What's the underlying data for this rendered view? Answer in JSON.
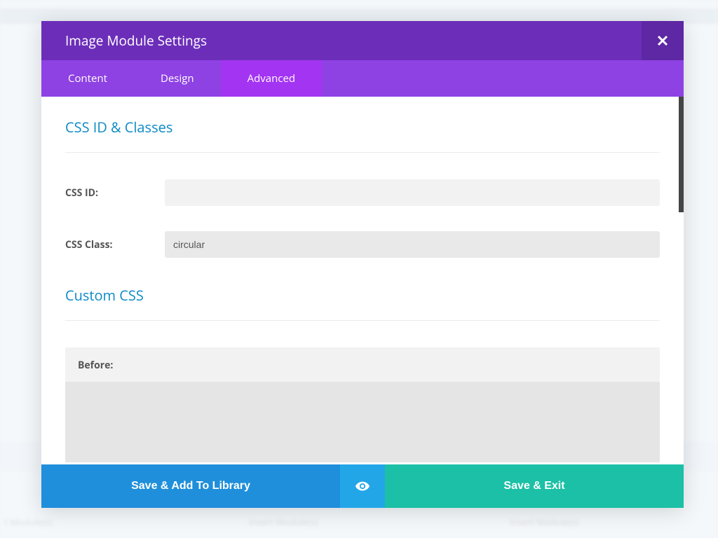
{
  "modal": {
    "title": "Image Module Settings",
    "tabs": [
      {
        "label": "Content",
        "active": false
      },
      {
        "label": "Design",
        "active": false
      },
      {
        "label": "Advanced",
        "active": true
      }
    ]
  },
  "sections": {
    "css_id_classes": {
      "title": "CSS ID & Classes",
      "fields": {
        "css_id": {
          "label": "CSS ID:",
          "value": ""
        },
        "css_class": {
          "label": "CSS Class:",
          "value": "circular"
        }
      }
    },
    "custom_css": {
      "title": "Custom CSS",
      "before": {
        "label": "Before:"
      }
    }
  },
  "footer": {
    "save_library": "Save & Add To Library",
    "save_exit": "Save & Exit"
  },
  "background": {
    "insert_module": "Insert Module(s)",
    "t_module": "t Module(s)"
  }
}
